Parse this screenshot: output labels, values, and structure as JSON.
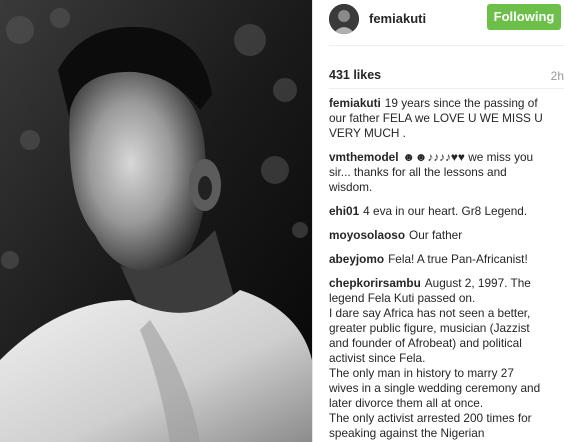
{
  "post": {
    "header": {
      "username": "femiakuti",
      "follow_label": "Following"
    },
    "likes": "431 likes",
    "time": "2h",
    "comments": [
      {
        "user": "femiakuti",
        "lines": [
          "19 years since the passing of",
          "our father FELA we LOVE U WE MISS U",
          "VERY MUCH ."
        ]
      },
      {
        "user": "vmthemodel",
        "lines": [
          "☻☻♪♪♪♪♥♥ we miss you",
          "sir... thanks for all the lessons and",
          "wisdom."
        ]
      },
      {
        "user": "ehi01",
        "lines": [
          "4 eva in our heart. Gr8 Legend."
        ]
      },
      {
        "user": "moyosolaoso",
        "lines": [
          "Our father"
        ]
      },
      {
        "user": "abeyjomo",
        "lines": [
          "Fela! A true Pan-Africanist!"
        ]
      },
      {
        "user": "chepkorirsambu",
        "lines": [
          "August 2, 1997. The",
          "legend Fela Kuti passed on.",
          "I dare say Africa has not seen a better,",
          "greater public figure, musician (Jazzist",
          "and founder of Afrobeat) and political",
          "activist since Fela.",
          "The only man in history to marry 27",
          "wives in a single wedding ceremony and",
          "later divorce them all at once.",
          "The only activist arrested 200 times for",
          "speaking against the Nigerian"
        ]
      }
    ]
  },
  "colors": {
    "follow_button": "#6cc04a",
    "username_text": "#262626",
    "timestamp": "#999999"
  }
}
